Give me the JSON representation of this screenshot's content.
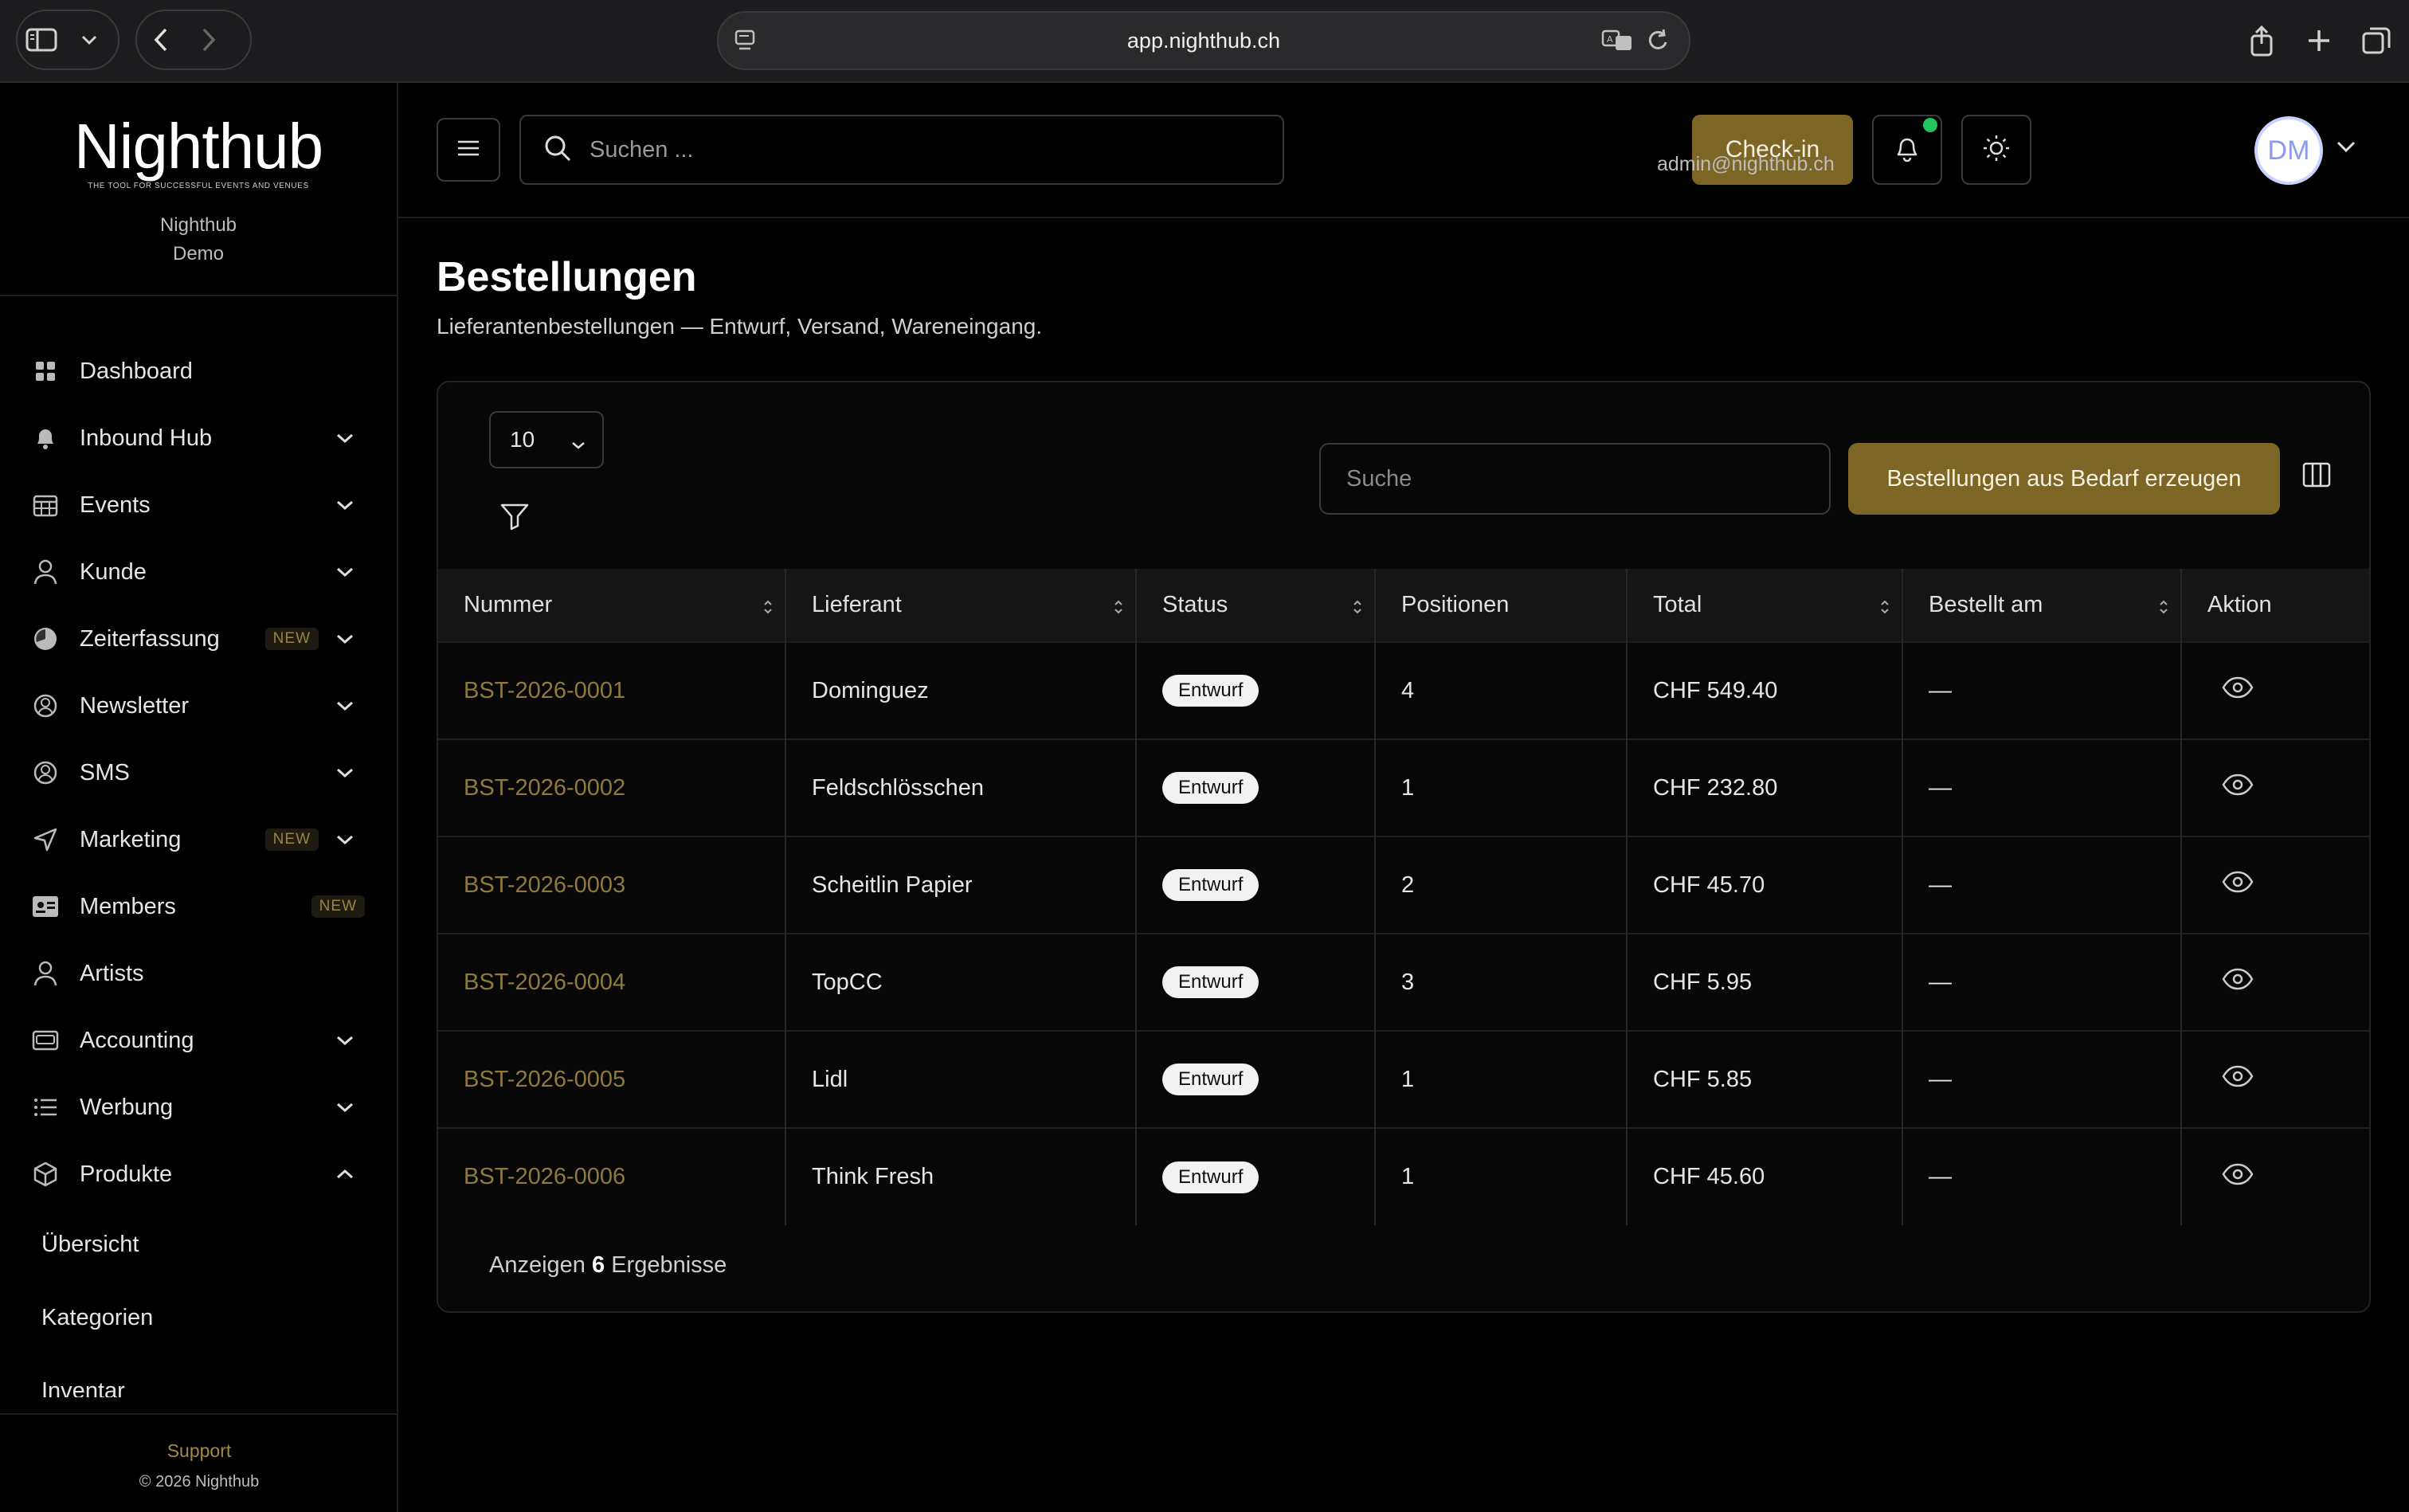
{
  "browser": {
    "url": "app.nighthub.ch"
  },
  "sidebar": {
    "logo": "Nighthub",
    "tagline": "THE TOOL FOR SUCCESSFUL EVENTS AND VENUES",
    "org_line1": "Nighthub",
    "org_line2": "Demo",
    "items": [
      {
        "label": "Dashboard",
        "icon": "dashboard-grid-icon",
        "badge": "",
        "chevron": ""
      },
      {
        "label": "Inbound Hub",
        "icon": "bell-icon",
        "badge": "",
        "chevron": "down"
      },
      {
        "label": "Events",
        "icon": "calendar-icon",
        "badge": "",
        "chevron": "down"
      },
      {
        "label": "Kunde",
        "icon": "user-icon",
        "badge": "",
        "chevron": "down"
      },
      {
        "label": "Zeiterfassung",
        "icon": "clock-icon",
        "badge": "NEW",
        "chevron": "down"
      },
      {
        "label": "Newsletter",
        "icon": "newsletter-icon",
        "badge": "",
        "chevron": "down"
      },
      {
        "label": "SMS",
        "icon": "sms-icon",
        "badge": "",
        "chevron": "down"
      },
      {
        "label": "Marketing",
        "icon": "send-icon",
        "badge": "NEW",
        "chevron": "down"
      },
      {
        "label": "Members",
        "icon": "id-card-icon",
        "badge": "NEW",
        "chevron": ""
      },
      {
        "label": "Artists",
        "icon": "user-icon",
        "badge": "",
        "chevron": ""
      },
      {
        "label": "Accounting",
        "icon": "wallet-icon",
        "badge": "",
        "chevron": "down"
      },
      {
        "label": "Werbung",
        "icon": "list-icon",
        "badge": "",
        "chevron": "down"
      },
      {
        "label": "Produkte",
        "icon": "box-icon",
        "badge": "",
        "chevron": "up"
      }
    ],
    "sub_items": [
      "Übersicht",
      "Kategorien",
      "Inventar"
    ],
    "support": "Support",
    "copyright": "© 2026 Nighthub"
  },
  "topbar": {
    "search_placeholder": "Suchen ...",
    "checkin_label": "Check-in",
    "user_email": "admin@nighthub.ch",
    "avatar_initials": "DM"
  },
  "page": {
    "title": "Bestellungen",
    "subtitle": "Lieferantenbestellungen — Entwurf, Versand, Wareneingang."
  },
  "table": {
    "per_page": "10",
    "search_placeholder": "Suche",
    "generate_button": "Bestellungen aus Bedarf erzeugen",
    "columns": [
      "Nummer",
      "Lieferant",
      "Status",
      "Positionen",
      "Total",
      "Bestellt am",
      "Aktion"
    ],
    "rows": [
      {
        "nummer": "BST-2026-0001",
        "lieferant": "Dominguez",
        "status": "Entwurf",
        "positionen": "4",
        "total": "CHF 549.40",
        "bestellt_am": "—"
      },
      {
        "nummer": "BST-2026-0002",
        "lieferant": "Feldschlösschen",
        "status": "Entwurf",
        "positionen": "1",
        "total": "CHF 232.80",
        "bestellt_am": "—"
      },
      {
        "nummer": "BST-2026-0003",
        "lieferant": "Scheitlin Papier",
        "status": "Entwurf",
        "positionen": "2",
        "total": "CHF 45.70",
        "bestellt_am": "—"
      },
      {
        "nummer": "BST-2026-0004",
        "lieferant": "TopCC",
        "status": "Entwurf",
        "positionen": "3",
        "total": "CHF 5.95",
        "bestellt_am": "—"
      },
      {
        "nummer": "BST-2026-0005",
        "lieferant": "Lidl",
        "status": "Entwurf",
        "positionen": "1",
        "total": "CHF 5.85",
        "bestellt_am": "—"
      },
      {
        "nummer": "BST-2026-0006",
        "lieferant": "Think Fresh",
        "status": "Entwurf",
        "positionen": "1",
        "total": "CHF 45.60",
        "bestellt_am": "—"
      }
    ],
    "footer_prefix": "Anzeigen",
    "footer_count": "6",
    "footer_suffix": "Ergebnisse"
  },
  "colors": {
    "accent": "#7d6625",
    "link": "#8f7a3e",
    "badge_new": "#9b8540",
    "online_dot": "#22c55e"
  }
}
